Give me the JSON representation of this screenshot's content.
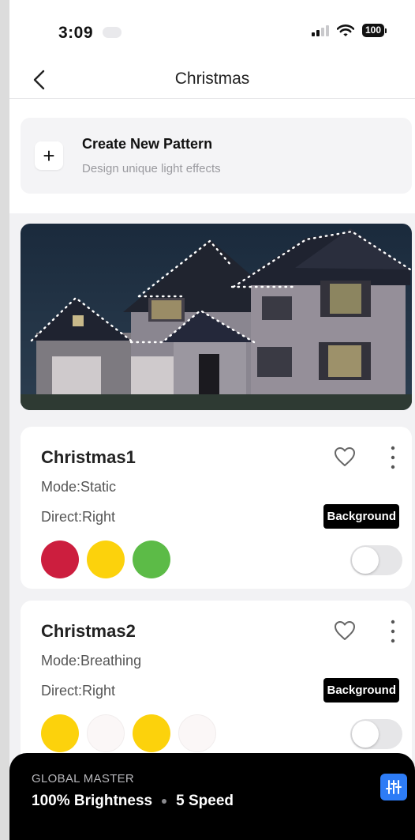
{
  "status_bar": {
    "time": "3:09",
    "battery": "100"
  },
  "nav": {
    "title": "Christmas",
    "back_icon": "chevron-left-icon"
  },
  "create": {
    "plus_icon": "plus-icon",
    "title": "Create New Pattern",
    "subtitle": "Design unique light effects"
  },
  "patterns": [
    {
      "name": "Christmas1",
      "mode": "Mode:Static",
      "direct": "Direct:Right",
      "background_label": "Background",
      "favorite": false,
      "enabled": false,
      "colors": [
        "#cc1e3e",
        "#fcd20c",
        "#5cbb47"
      ]
    },
    {
      "name": "Christmas2",
      "mode": "Mode:Breathing",
      "direct": "Direct:Right",
      "background_label": "Background",
      "favorite": false,
      "enabled": false,
      "colors": [
        "#fcd20c",
        "#fbf7f7",
        "#fcd20c",
        "#fbf7f7"
      ]
    }
  ],
  "master": {
    "label": "GLOBAL MASTER",
    "brightness": "100% Brightness",
    "speed": "5 Speed",
    "settings_icon": "sliders-icon"
  },
  "colors": {
    "accent": "#2d7cf6",
    "background": "#f2f2f4"
  }
}
